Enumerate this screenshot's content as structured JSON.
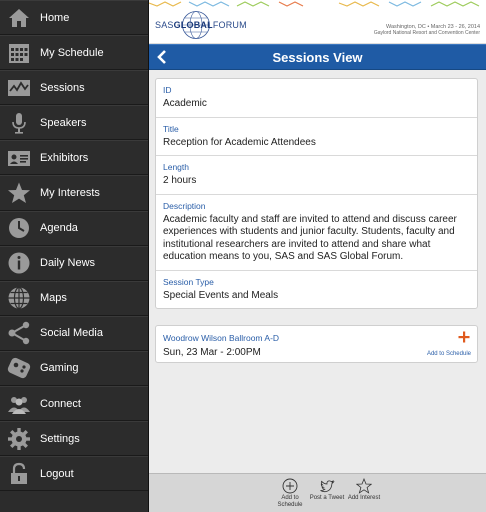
{
  "sidebar": {
    "items": [
      {
        "label": "Home",
        "icon": "home-icon"
      },
      {
        "label": "My Schedule",
        "icon": "calendar-icon"
      },
      {
        "label": "Sessions",
        "icon": "sessions-icon"
      },
      {
        "label": "Speakers",
        "icon": "microphone-icon"
      },
      {
        "label": "Exhibitors",
        "icon": "id-card-icon"
      },
      {
        "label": "My Interests",
        "icon": "star-icon"
      },
      {
        "label": "Agenda",
        "icon": "clock-icon"
      },
      {
        "label": "Daily News",
        "icon": "info-icon"
      },
      {
        "label": "Maps",
        "icon": "globe-icon"
      },
      {
        "label": "Social Media",
        "icon": "share-icon"
      },
      {
        "label": "Gaming",
        "icon": "gamepad-icon"
      },
      {
        "label": "Connect",
        "icon": "people-icon"
      },
      {
        "label": "Settings",
        "icon": "gear-icon"
      },
      {
        "label": "Logout",
        "icon": "lock-icon"
      }
    ]
  },
  "banner": {
    "logo_prefix": "SAS",
    "logo_main": "GLOBAL",
    "logo_suffix": "FORUM",
    "location": "Washington, DC • March 23 - 26, 2014",
    "venue": "Gaylord National Resort and Convention Center"
  },
  "header": {
    "title": "Sessions View"
  },
  "session": {
    "fields": [
      {
        "label": "ID",
        "value": "Academic"
      },
      {
        "label": "Title",
        "value": "Reception for Academic Attendees"
      },
      {
        "label": "Length",
        "value": "2 hours"
      },
      {
        "label": "Description",
        "value": "Academic faculty and staff are invited to attend and discuss career experiences with students and junior faculty. Students, faculty and institutional researchers are invited to attend and share what education means to you, SAS and SAS Global Forum."
      },
      {
        "label": "Session Type",
        "value": "Special Events and Meals"
      }
    ]
  },
  "occurrence": {
    "location": "Woodrow Wilson Ballroom A-D",
    "datetime": "Sun, 23 Mar - 2:00PM",
    "add_label": "Add to Schedule"
  },
  "toolbar": {
    "add_schedule": "Add to Schedule",
    "post_tweet": "Post a Tweet",
    "add_interest": "Add Interest"
  },
  "colors": {
    "accent": "#1f5ba5",
    "sidebar_bg": "#2c2c2c",
    "link": "#2a5ea8",
    "add_icon": "#e05a1e"
  }
}
